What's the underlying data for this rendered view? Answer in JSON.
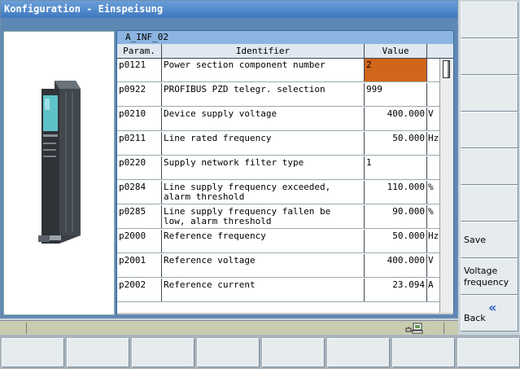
{
  "window": {
    "title": "Konfiguration - Einspeisung"
  },
  "table": {
    "title": "A_INF_02",
    "headers": {
      "param": "Param.",
      "identifier": "Identifier",
      "value": "Value"
    },
    "rows": [
      {
        "param": "p0121",
        "identifier": "Power section component number",
        "value": "2",
        "unit": "",
        "highlight": true,
        "align": "left"
      },
      {
        "param": "p0922",
        "identifier": "PROFIBUS PZD telegr. selection",
        "value": "999",
        "unit": "",
        "align": "left"
      },
      {
        "param": "p0210",
        "identifier": "Device supply voltage",
        "value": "400.000",
        "unit": "V"
      },
      {
        "param": "p0211",
        "identifier": "Line rated frequency",
        "value": "50.000",
        "unit": "Hz"
      },
      {
        "param": "p0220",
        "identifier": "Supply network filter type",
        "value": "1",
        "unit": "",
        "align": "left"
      },
      {
        "param": "p0284",
        "identifier": "Line supply frequency exceeded,\n alarm threshold",
        "value": "110.000",
        "unit": "%"
      },
      {
        "param": "p0285",
        "identifier": "Line supply frequency fallen be\nlow, alarm threshold",
        "value": "90.000",
        "unit": "%"
      },
      {
        "param": "p2000",
        "identifier": "Reference frequency",
        "value": "50.000",
        "unit": "Hz"
      },
      {
        "param": "p2001",
        "identifier": "Reference voltage",
        "value": "400.000",
        "unit": "V"
      },
      {
        "param": "p2002",
        "identifier": "Reference current",
        "value": "23.094",
        "unit": "A"
      }
    ]
  },
  "softkeys": {
    "right": [
      "",
      "",
      "",
      "",
      "",
      "",
      "Save",
      "Voltage\nfrequency",
      "Back"
    ]
  },
  "icons": {
    "status": "network-icon",
    "back": "double-chevron-left-icon"
  },
  "colors": {
    "title_bar": "#3f78c0",
    "highlight_cell": "#d0661a",
    "table_header": "#8bb4e0"
  }
}
